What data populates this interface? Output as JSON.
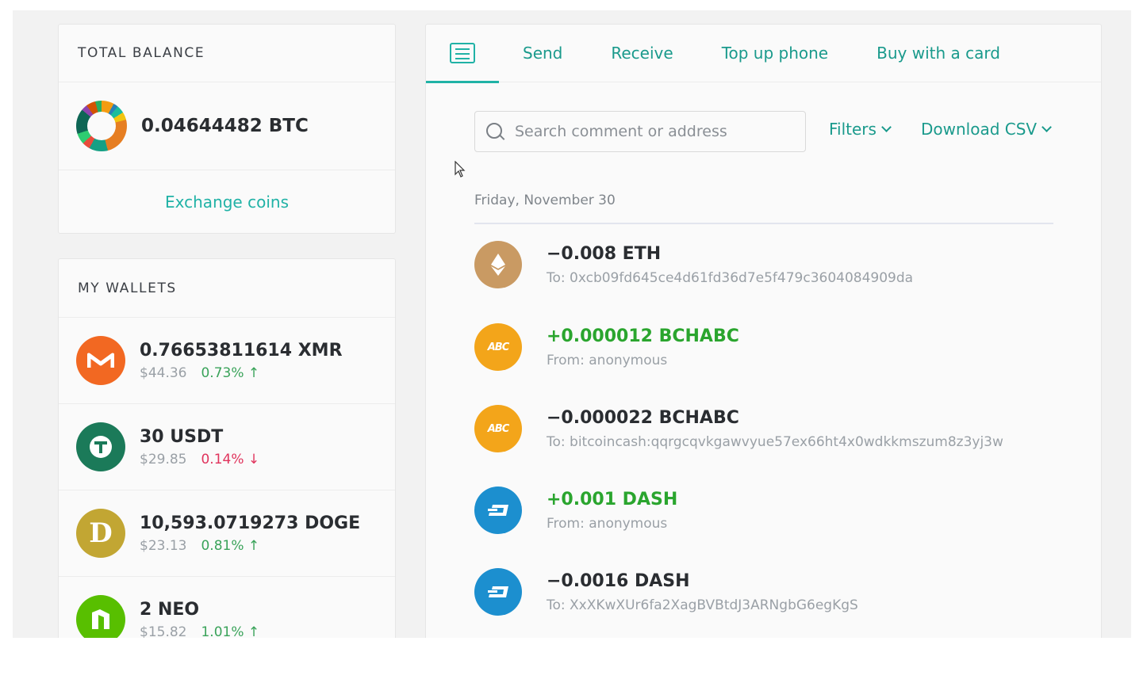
{
  "balance": {
    "heading": "TOTAL BALANCE",
    "total": "0.04644482 BTC",
    "exchange_label": "Exchange coins"
  },
  "wallets": {
    "heading": "MY WALLETS",
    "items": [
      {
        "amount": "0.76653811614 XMR",
        "usd": "$44.36",
        "change": "0.73% ↑",
        "trend": "up",
        "icon": "monero-icon"
      },
      {
        "amount": "30 USDT",
        "usd": "$29.85",
        "change": "0.14% ↓",
        "trend": "down",
        "icon": "tether-icon"
      },
      {
        "amount": "10,593.0719273 DOGE",
        "usd": "$23.13",
        "change": "0.81% ↑",
        "trend": "up",
        "icon": "dogecoin-icon"
      },
      {
        "amount": "2 NEO",
        "usd": "$15.82",
        "change": "1.01% ↑",
        "trend": "up",
        "icon": "neo-icon"
      }
    ]
  },
  "tabs": {
    "send": "Send",
    "receive": "Receive",
    "topup": "Top up phone",
    "buy": "Buy with a card"
  },
  "search": {
    "placeholder": "Search comment or address"
  },
  "filters_label": "Filters",
  "download_label": "Download CSV",
  "date_group": "Friday, November 30",
  "transactions": [
    {
      "amount": "−0.008 ETH",
      "detail": "To: 0xcb09fd645ce4d61fd36d7e5f479c3604084909da",
      "direction": "out",
      "icon": "ethereum-icon"
    },
    {
      "amount": "+0.000012 BCHABC",
      "detail": "From: anonymous",
      "direction": "in",
      "icon": "bitcoin-cash-abc-icon"
    },
    {
      "amount": "−0.000022 BCHABC",
      "detail": "To: bitcoincash:qqrgcqvkgawvyue57ex66ht4x0wdkkmszum8z3yj3w",
      "direction": "out",
      "icon": "bitcoin-cash-abc-icon"
    },
    {
      "amount": "+0.001 DASH",
      "detail": "From: anonymous",
      "direction": "in",
      "icon": "dash-icon"
    },
    {
      "amount": "−0.0016 DASH",
      "detail": "To: XxXKwXUr6fa2XagBVBtdJ3ARNgbG6egKgS",
      "direction": "out",
      "icon": "dash-icon"
    }
  ],
  "colors": {
    "accent": "#20b2a6",
    "positive": "#2aa52e",
    "negative_change": "#e0335c"
  }
}
